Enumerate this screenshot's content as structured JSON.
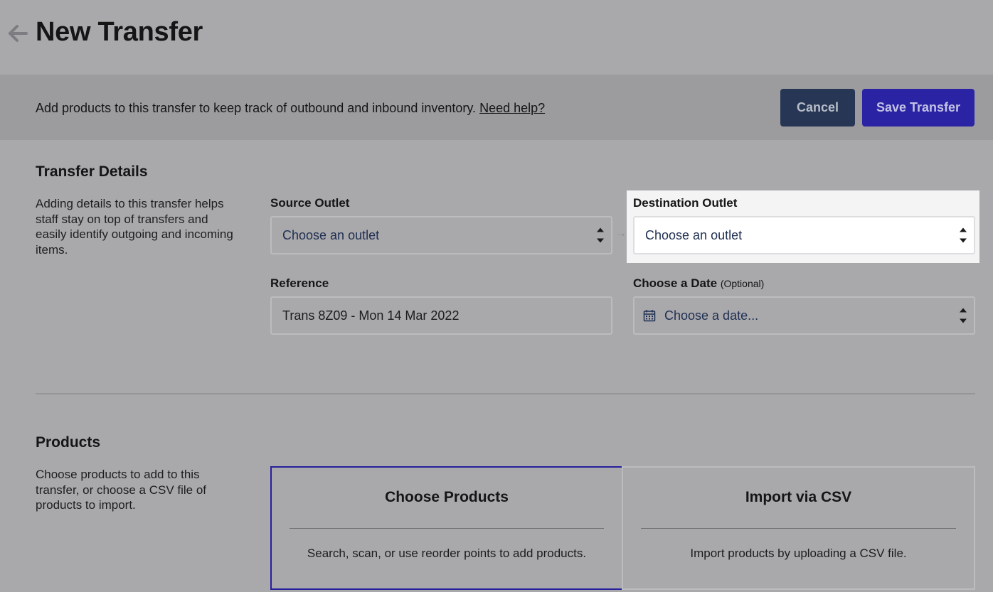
{
  "header": {
    "title": "New Transfer",
    "back_icon": "arrow-left-icon"
  },
  "banner": {
    "text": "Add products to this transfer to keep track of outbound and inbound inventory.",
    "help_link": "Need help?",
    "cancel_label": "Cancel",
    "save_label": "Save Transfer"
  },
  "details": {
    "title": "Transfer Details",
    "description": "Adding details to this transfer helps staff stay on top of transfers and easily identify outgoing and incoming items.",
    "source": {
      "label": "Source Outlet",
      "value": "Choose an outlet"
    },
    "destination": {
      "label": "Destination Outlet",
      "value": "Choose an outlet"
    },
    "reference": {
      "label": "Reference",
      "value": "Trans 8Z09 - Mon 14 Mar 2022"
    },
    "date": {
      "label": "Choose a Date",
      "optional": "(Optional)",
      "value": "Choose a date..."
    }
  },
  "products": {
    "title": "Products",
    "description": "Choose products to add to this transfer, or choose a CSV file of products to import.",
    "options": [
      {
        "title": "Choose Products",
        "description": "Search, scan, or use reorder points to add products."
      },
      {
        "title": "Import via CSV",
        "description": "Import products by uploading a CSV file."
      }
    ]
  },
  "colors": {
    "cancel_bg": "#263654",
    "save_bg": "#2a24a5",
    "selected_border": "#26209c"
  }
}
